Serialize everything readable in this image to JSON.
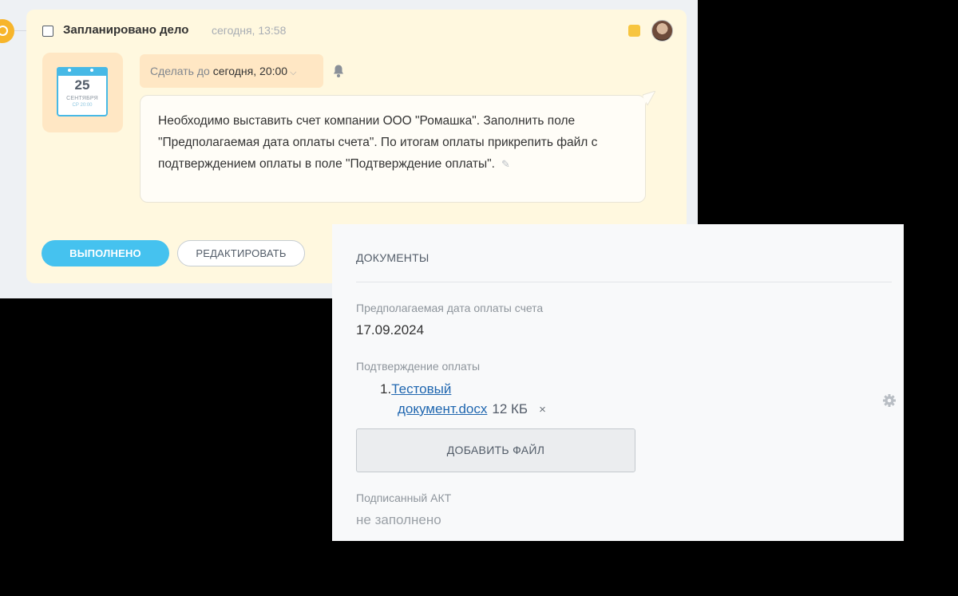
{
  "task": {
    "title": "Запланировано дело",
    "created_time": "сегодня, 13:58",
    "calendar": {
      "day": "25",
      "month": "СЕНТЯБРЯ",
      "sub": "СР 20:00"
    },
    "deadline_prefix": "Сделать до",
    "deadline_value": "сегодня, 20:00",
    "chevron": "⌵",
    "description": "Необходимо выставить счет компании ООО \"Ромашка\". Заполнить поле \"Предполагаемая дата оплаты счета\". По итогам оплаты прикрепить файл с подтверждением оплаты в поле \"Подтверждение оплаты\".",
    "done_label": "ВЫПОЛНЕНО",
    "edit_label": "РЕДАКТИРОВАТЬ",
    "flag_color": "#f7c53f",
    "accent_color": "#45c2ef"
  },
  "documents": {
    "title": "ДОКУМЕНТЫ",
    "payment_date_label": "Предполагаемая дата оплаты счета",
    "payment_date_value": "17.09.2024",
    "confirmation_label": "Подтверждение оплаты",
    "files": [
      {
        "index": "1.",
        "name_line1": "Тестовый",
        "name_line2": "документ.docx",
        "size": "12 КБ",
        "remove": "×"
      }
    ],
    "add_file_label": "ДОБАВИТЬ ФАЙЛ",
    "act_label": "Подписанный АКТ",
    "act_value": "не заполнено"
  }
}
